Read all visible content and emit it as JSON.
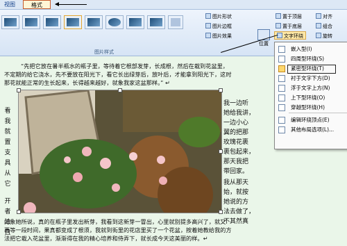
{
  "tabs": {
    "view": "视图",
    "format": "格式"
  },
  "ribbon": {
    "group_label": "图片样式",
    "buttons": {
      "shape": "图片形状",
      "border": "图片边框",
      "effect": "图片效果",
      "top": "置于顶层",
      "bottom": "置于底层",
      "wrap": "文字环绕",
      "align": "对齐",
      "group": "组合",
      "rotate": "旋转",
      "position": "位置"
    }
  },
  "doc": {
    "p1": [
      "“先把它放在暑半瓶水的瓶子里，等待着它根部发芽，长成根，然后在栽到花盆里，",
      "不定期的给它浇水，先不要放在阳光下，看它长出绿芽后，放叶后，才能拿到阳光下，这时",
      "那花就能正常的生长起来，长得越来越好，就象我家这盆那样。” ↵"
    ],
    "left_col": [
      "看",
      "我",
      "就",
      "置",
      "支",
      "具",
      "从",
      "它",
      "",
      "开",
      "者",
      "法",
      "且"
    ],
    "right_col": [
      "我一边听",
      "她给我讲，",
      "一边小心",
      "翼的把那",
      "玫瑰花裹",
      "裹包起来，",
      "那天我把",
      "带回家。",
      "我从那天",
      "始，就按",
      "她说的方",
      "法去做了，",
      "不其然真"
    ],
    "bottom": [
      "的象她所说，真的在瓶子里发出新芽，我看到这新芽一冒出，心里就别提多高兴了，就又",
      "再等一段时间，果真都变成了根须，我就到街里的花店里买了一个花盆，按着她教给我的方",
      "法把它栽入花盆里，渐渐得在我的精心培养和侍弄下，就长成今天这美丽的样。↵"
    ]
  },
  "menu": {
    "items": [
      {
        "label": "嵌入型(I)",
        "active": false
      },
      {
        "label": "四周型环绕(S)",
        "active": false
      },
      {
        "label": "紧密型环绕(T)",
        "active": true
      },
      {
        "label": "衬于文字下方(D)",
        "active": false
      },
      {
        "label": "浮于文字上方(N)",
        "active": false
      },
      {
        "label": "上下型环绕(O)",
        "active": false
      },
      {
        "label": "穿越型环绕(H)",
        "active": false
      },
      {
        "label": "编辑环绕顶点(E)",
        "active": false
      },
      {
        "label": "其他布局选项(L)...",
        "active": false
      }
    ]
  }
}
